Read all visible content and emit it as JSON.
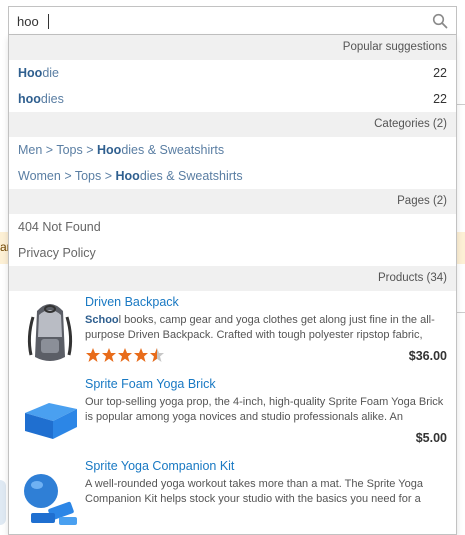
{
  "search": {
    "value": "hoo"
  },
  "sections": {
    "popular": "Popular suggestions",
    "categories": "Categories (2)",
    "pages": "Pages (2)",
    "products": "Products (34)"
  },
  "popular": [
    {
      "match": "Hoo",
      "rest": "die",
      "count": "22"
    },
    {
      "match": "hoo",
      "rest": "dies",
      "count": "22"
    }
  ],
  "categories": [
    {
      "prefix": "Men > Tops > ",
      "match": "Hoo",
      "rest": "dies & Sweatshirts"
    },
    {
      "prefix": "Women > Tops > ",
      "match": "Hoo",
      "rest": "dies & Sweatshirts"
    }
  ],
  "pages": [
    {
      "label": "404 Not Found"
    },
    {
      "label": "Privacy Policy"
    }
  ],
  "products": [
    {
      "name": "Driven Backpack",
      "desc_match": "Sch",
      "desc_match2": "oo",
      "desc_rest": "l books, camp gear and yoga clothes get along just fine in the all-purpose Driven Backpack. Crafted with tough polyester ripstop fabric,",
      "rating": 4.5,
      "price": "$36.00"
    },
    {
      "name": "Sprite Foam Yoga Brick",
      "desc": "Our top-selling yoga prop, the 4-inch, high-quality Sprite Foam Yoga Brick is popular among yoga novices and studio professionals alike. An",
      "price": "$5.00"
    },
    {
      "name": "Sprite Yoga Companion Kit",
      "desc": "A well-rounded yoga workout takes more than a mat. The Sprite Yoga Companion Kit helps stock your studio with the basics you need for a"
    }
  ],
  "background": {
    "notice_fragment": "ar"
  },
  "colors": {
    "link": "#1979c3",
    "star": "#e86c1b",
    "star_empty": "#c7c7c7",
    "header_bg": "#f0f0f0"
  }
}
